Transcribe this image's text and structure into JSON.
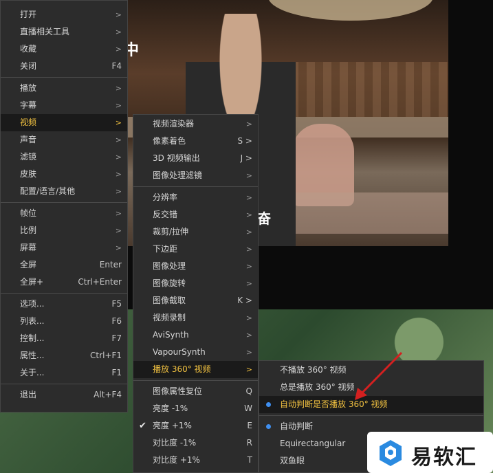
{
  "menu_main": [
    {
      "label": "打开",
      "arrow": ">",
      "type": "item"
    },
    {
      "label": "直播相关工具",
      "arrow": ">",
      "type": "item"
    },
    {
      "label": "收藏",
      "arrow": ">",
      "type": "item"
    },
    {
      "label": "关闭",
      "shortcut": "F4",
      "type": "item"
    },
    {
      "type": "sep"
    },
    {
      "label": "播放",
      "arrow": ">",
      "type": "item"
    },
    {
      "label": "字幕",
      "arrow": ">",
      "type": "item"
    },
    {
      "label": "视频",
      "arrow": ">",
      "type": "item",
      "highlight": true
    },
    {
      "label": "声音",
      "arrow": ">",
      "type": "item"
    },
    {
      "label": "滤镜",
      "arrow": ">",
      "type": "item"
    },
    {
      "label": "皮肤",
      "arrow": ">",
      "type": "item"
    },
    {
      "label": "配置/语言/其他",
      "arrow": ">",
      "type": "item"
    },
    {
      "type": "sep"
    },
    {
      "label": "帧位",
      "arrow": ">",
      "type": "item"
    },
    {
      "label": "比例",
      "arrow": ">",
      "type": "item"
    },
    {
      "label": "屏幕",
      "arrow": ">",
      "type": "item"
    },
    {
      "label": "全屏",
      "shortcut": "Enter",
      "type": "item"
    },
    {
      "label": "全屏+",
      "shortcut": "Ctrl+Enter",
      "type": "item"
    },
    {
      "type": "sep"
    },
    {
      "label": "选项...",
      "shortcut": "F5",
      "type": "item"
    },
    {
      "label": "列表...",
      "shortcut": "F6",
      "type": "item"
    },
    {
      "label": "控制...",
      "shortcut": "F7",
      "type": "item"
    },
    {
      "label": "属性...",
      "shortcut": "Ctrl+F1",
      "type": "item"
    },
    {
      "label": "关于...",
      "shortcut": "F1",
      "type": "item"
    },
    {
      "type": "sep"
    },
    {
      "label": "退出",
      "shortcut": "Alt+F4",
      "type": "item"
    }
  ],
  "menu_video": [
    {
      "label": "视频渲染器",
      "arrow": ">",
      "type": "item"
    },
    {
      "label": "像素着色",
      "shortcut": "S >",
      "type": "item"
    },
    {
      "label": "3D 视频输出",
      "shortcut": "J >",
      "type": "item"
    },
    {
      "label": "图像处理滤镜",
      "arrow": ">",
      "type": "item"
    },
    {
      "type": "sep"
    },
    {
      "label": "分辨率",
      "arrow": ">",
      "type": "item"
    },
    {
      "label": "反交错",
      "arrow": ">",
      "type": "item"
    },
    {
      "label": "裁剪/拉伸",
      "arrow": ">",
      "type": "item"
    },
    {
      "label": "下边距",
      "arrow": ">",
      "type": "item"
    },
    {
      "label": "图像处理",
      "arrow": ">",
      "type": "item"
    },
    {
      "label": "图像旋转",
      "arrow": ">",
      "type": "item"
    },
    {
      "label": "图像截取",
      "shortcut": "K >",
      "type": "item"
    },
    {
      "label": "视频录制",
      "arrow": ">",
      "type": "item"
    },
    {
      "label": "AviSynth",
      "arrow": ">",
      "type": "item"
    },
    {
      "label": "VapourSynth",
      "arrow": ">",
      "type": "item"
    },
    {
      "label": "播放 360° 视频",
      "arrow": ">",
      "type": "item",
      "highlight": true
    },
    {
      "type": "sep"
    },
    {
      "label": "图像属性复位",
      "shortcut": "Q",
      "type": "item"
    },
    {
      "label": "亮度 -1%",
      "shortcut": "W",
      "type": "item"
    },
    {
      "label": "亮度 +1%",
      "shortcut": "E",
      "type": "item",
      "checked": true
    },
    {
      "label": "对比度 -1%",
      "shortcut": "R",
      "type": "item"
    },
    {
      "label": "对比度 +1%",
      "shortcut": "T",
      "type": "item"
    }
  ],
  "menu_360": [
    {
      "label": "不播放 360° 视频",
      "type": "item"
    },
    {
      "label": "总是播放 360° 视频",
      "type": "item"
    },
    {
      "label": "自动判断是否播放 360° 视频",
      "type": "item",
      "highlight": true,
      "radio": true
    },
    {
      "type": "sep"
    },
    {
      "label": "自动判断",
      "type": "item",
      "radio": true
    },
    {
      "label": "Equirectangular",
      "type": "item"
    },
    {
      "label": "双鱼眼",
      "type": "item"
    }
  ],
  "subtitle_fragments": [
    "中",
    "奋"
  ],
  "watermark": {
    "text": "易软汇"
  },
  "colors": {
    "menu_bg": "#2c2c2c",
    "highlight_text": "#f0c040",
    "radio_dot": "#3f8ff0",
    "annotation_arrow": "#d42020"
  }
}
